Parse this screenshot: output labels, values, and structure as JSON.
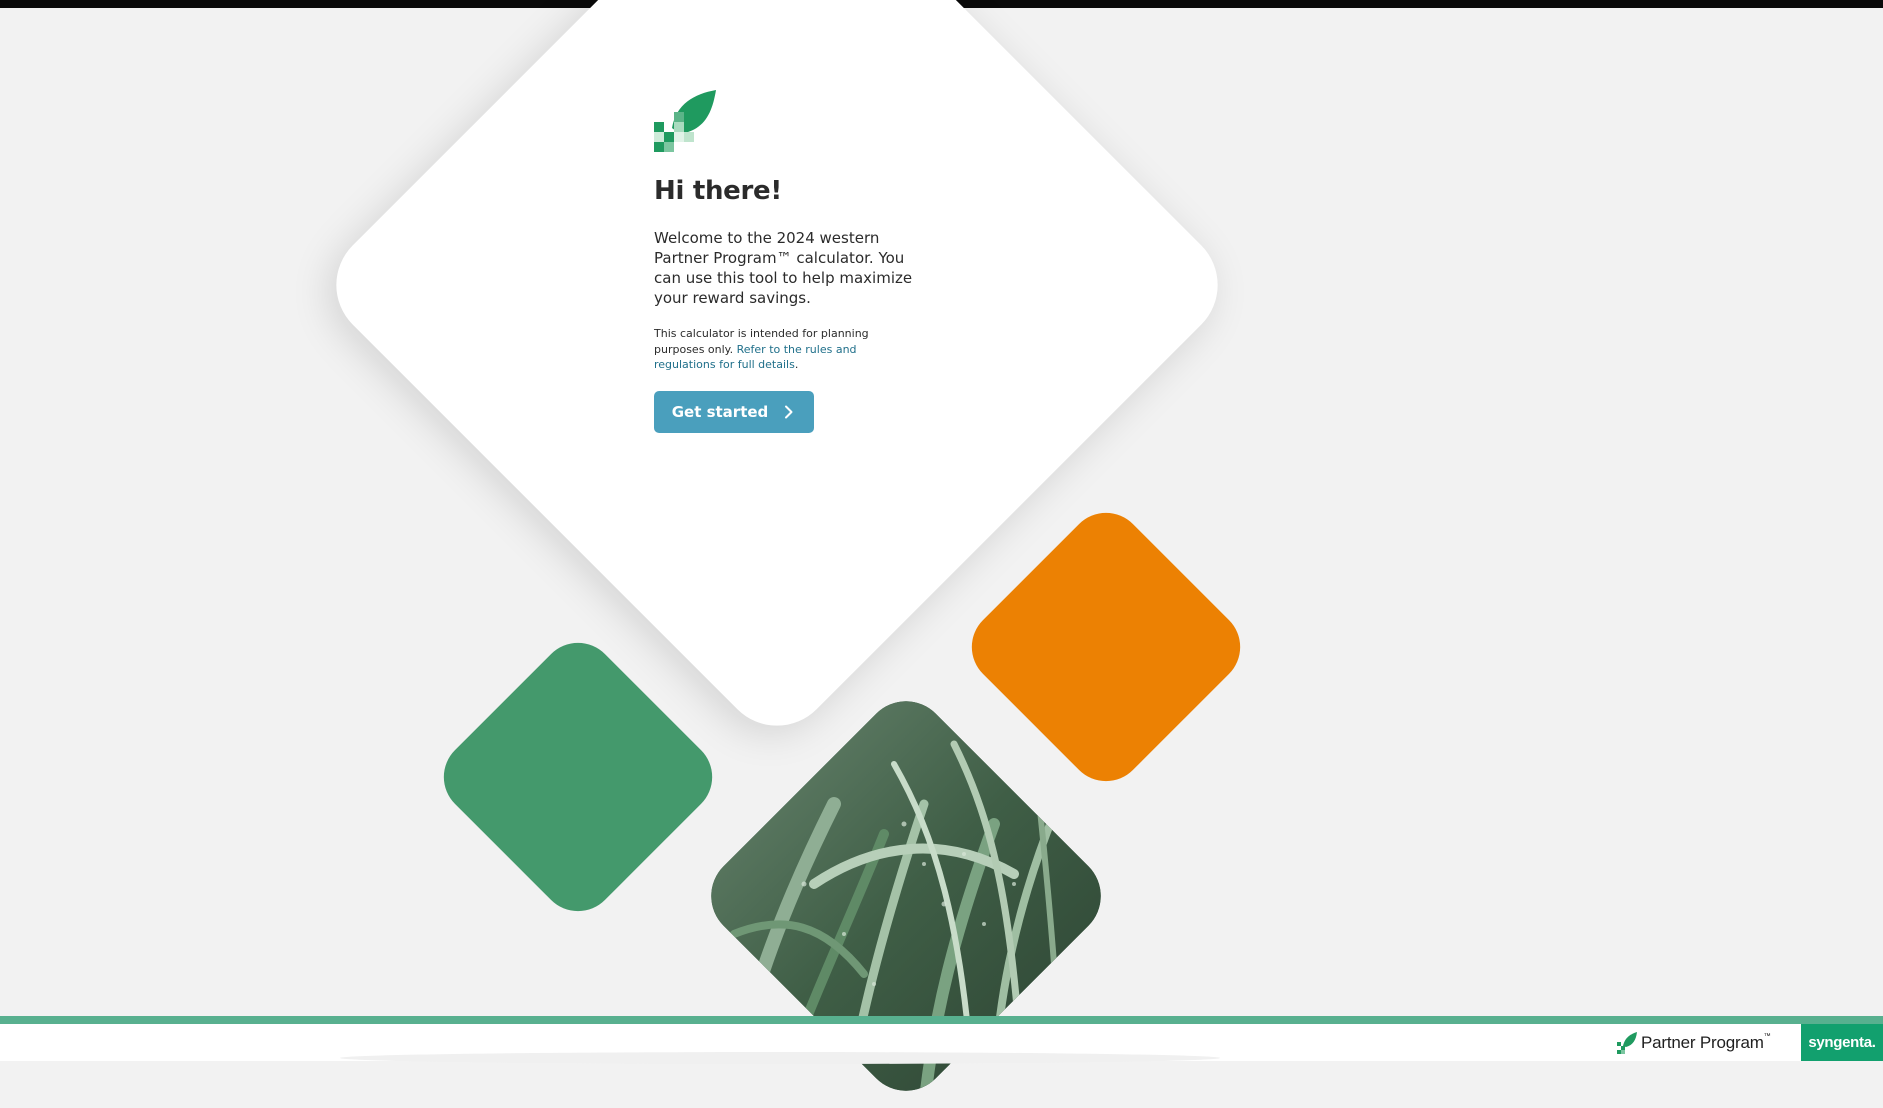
{
  "welcome": {
    "title": "Hi there!",
    "intro": "Welcome to the 2024 western Partner Program™ calculator. You can use this tool to help maximize your reward savings.",
    "disclaimer_prefix": "This calculator is intended for planning purposes only.",
    "disclaimer_link": "Refer to the rules and regulations for full details",
    "disclaimer_suffix": ".",
    "cta_label": "Get started"
  },
  "footer": {
    "program_name": "Partner Program",
    "program_mark": "™",
    "brand": "syngenta."
  },
  "colors": {
    "accent_blue": "#4a9fbd",
    "link": "#1f6f8a",
    "green": "#44996c",
    "orange": "#ec8103",
    "footer_green": "#58b08f",
    "brand_green": "#12a06e"
  },
  "icons": {
    "logo": "leaf-pixel-logo-icon",
    "cta": "chevron-right-icon"
  }
}
